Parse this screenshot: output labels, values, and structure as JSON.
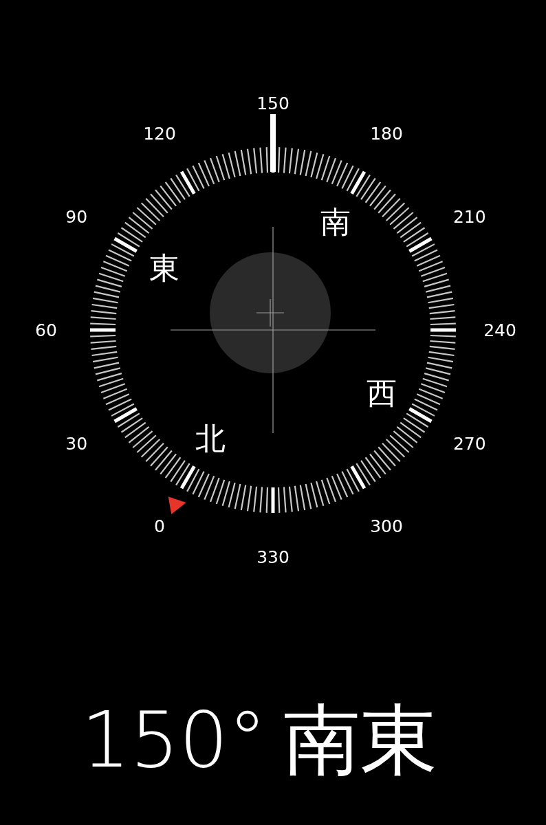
{
  "dial": {
    "degree_labels": [
      "0",
      "30",
      "60",
      "90",
      "120",
      "150",
      "180",
      "210",
      "240",
      "270",
      "300",
      "330"
    ],
    "cardinals": [
      "北",
      "東",
      "南",
      "西"
    ]
  },
  "readout": {
    "degrees": "150°",
    "direction": "南東"
  }
}
